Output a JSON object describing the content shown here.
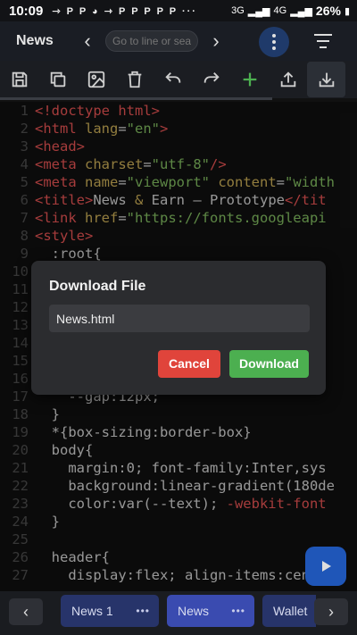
{
  "status": {
    "time": "10:09",
    "notifications": "⇾ P P ◕ ⇾ P P P P P ···",
    "network1": "3G",
    "network2": "4G",
    "battery": "26%"
  },
  "appbar": {
    "title": "News",
    "goto_placeholder": "Go to line or search"
  },
  "toolbar": {
    "items": [
      "save-icon",
      "copy-icon",
      "image-icon",
      "delete-icon",
      "undo-icon",
      "redo-icon",
      "add-icon",
      "upload-icon",
      "download-icon"
    ]
  },
  "editor": {
    "lines": [
      {
        "n": "1",
        "parts": [
          [
            "tag",
            "<!doctype html>"
          ]
        ]
      },
      {
        "n": "2",
        "parts": [
          [
            "tag",
            "<html "
          ],
          [
            "attr",
            "lang"
          ],
          [
            "txt",
            "="
          ],
          [
            "str",
            "\"en\""
          ],
          [
            "tag",
            ">"
          ]
        ]
      },
      {
        "n": "3",
        "parts": [
          [
            "tag",
            "<head>"
          ]
        ]
      },
      {
        "n": "4",
        "parts": [
          [
            "tag",
            "<meta "
          ],
          [
            "attr",
            "charset"
          ],
          [
            "txt",
            "="
          ],
          [
            "str",
            "\"utf-8\""
          ],
          [
            "tag",
            "/>"
          ]
        ]
      },
      {
        "n": "5",
        "parts": [
          [
            "tag",
            "<meta "
          ],
          [
            "attr",
            "name"
          ],
          [
            "txt",
            "="
          ],
          [
            "str",
            "\"viewport\""
          ],
          [
            "txt",
            " "
          ],
          [
            "attr",
            "content"
          ],
          [
            "txt",
            "="
          ],
          [
            "str",
            "\"width"
          ]
        ]
      },
      {
        "n": "6",
        "parts": [
          [
            "tag",
            "<title>"
          ],
          [
            "txt",
            "News "
          ],
          [
            "attr",
            "&"
          ],
          [
            "txt",
            " Earn — Prototype"
          ],
          [
            "tag",
            "</tit"
          ]
        ]
      },
      {
        "n": "7",
        "parts": [
          [
            "tag",
            "<link "
          ],
          [
            "attr",
            "href"
          ],
          [
            "txt",
            "="
          ],
          [
            "str",
            "\"https://fonts.googleapi"
          ]
        ]
      },
      {
        "n": "8",
        "parts": [
          [
            "tag",
            "<style>"
          ]
        ]
      },
      {
        "n": "9",
        "parts": [
          [
            "txt",
            "  :root{"
          ]
        ]
      },
      {
        "n": "10",
        "parts": []
      },
      {
        "n": "11",
        "parts": []
      },
      {
        "n": "12",
        "parts": []
      },
      {
        "n": "13",
        "parts": []
      },
      {
        "n": "14",
        "parts": []
      },
      {
        "n": "15",
        "parts": []
      },
      {
        "n": "16",
        "parts": []
      },
      {
        "n": "17",
        "parts": [
          [
            "txt",
            "    --gap:12px;"
          ]
        ]
      },
      {
        "n": "18",
        "parts": [
          [
            "txt",
            "  }"
          ]
        ]
      },
      {
        "n": "19",
        "parts": [
          [
            "txt",
            "  *{box-sizing:border-box}"
          ]
        ]
      },
      {
        "n": "20",
        "parts": [
          [
            "txt",
            "  body{"
          ]
        ]
      },
      {
        "n": "21",
        "parts": [
          [
            "txt",
            "    margin:0; font-family:Inter,sys"
          ]
        ]
      },
      {
        "n": "22",
        "parts": [
          [
            "txt",
            "    background:linear-gradient(180de"
          ]
        ]
      },
      {
        "n": "23",
        "parts": [
          [
            "txt",
            "    color:var(--text); "
          ],
          [
            "tag",
            "-webkit-font"
          ]
        ]
      },
      {
        "n": "24",
        "parts": [
          [
            "txt",
            "  }"
          ]
        ]
      },
      {
        "n": "25",
        "parts": []
      },
      {
        "n": "26",
        "parts": [
          [
            "txt",
            "  header{"
          ]
        ]
      },
      {
        "n": "27",
        "parts": [
          [
            "txt",
            "    display:flex; align-items:center"
          ]
        ]
      }
    ]
  },
  "dialog": {
    "title": "Download File",
    "filename": "News.html",
    "cancel": "Cancel",
    "download": "Download"
  },
  "tabs": {
    "prev": "‹",
    "next": "›",
    "items": [
      {
        "label": "News 1",
        "dots": "•••"
      },
      {
        "label": "News",
        "dots": "•••"
      },
      {
        "label": "Wallet"
      }
    ]
  }
}
